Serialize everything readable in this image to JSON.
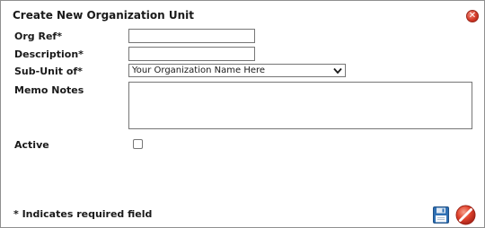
{
  "dialog": {
    "title": "Create New Organization Unit",
    "close_icon": "close-icon"
  },
  "form": {
    "org_ref": {
      "label": "Org Ref*",
      "value": ""
    },
    "description": {
      "label": "Description*",
      "value": ""
    },
    "sub_unit_of": {
      "label": "Sub-Unit of*",
      "selected": "Your Organization Name Here"
    },
    "memo_notes": {
      "label": "Memo Notes",
      "value": ""
    },
    "active": {
      "label": "Active",
      "checked": false
    }
  },
  "footer": {
    "required_note": "* Indicates required field",
    "save_icon": "floppy-disk-icon",
    "cancel_icon": "no-entry-icon"
  },
  "colors": {
    "close_red": "#d43a28",
    "save_blue": "#2e6fb3",
    "cancel_red": "#e0422c"
  }
}
